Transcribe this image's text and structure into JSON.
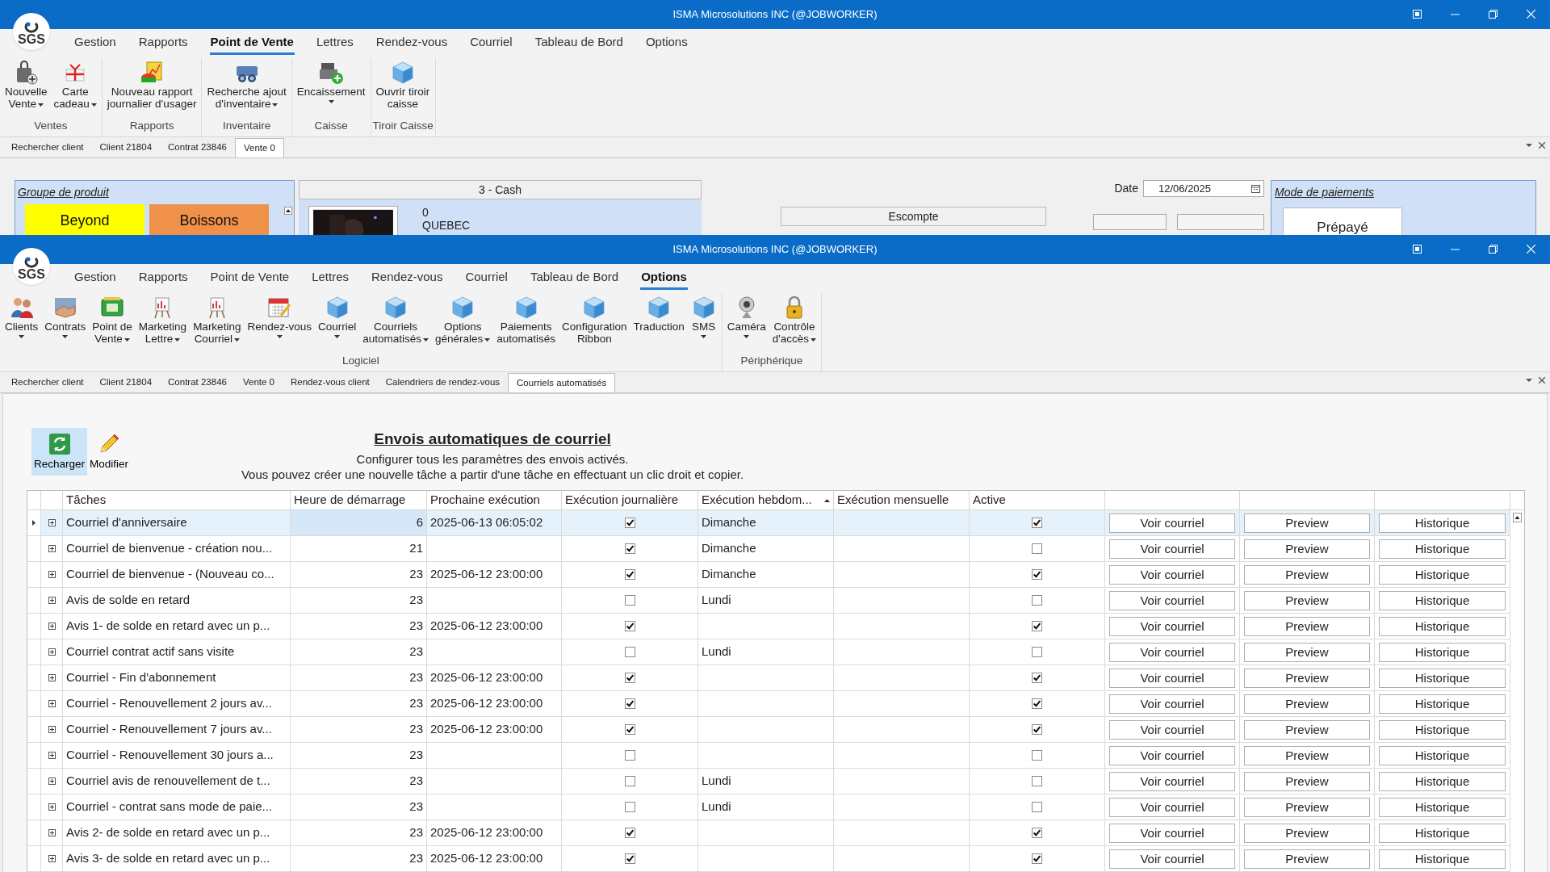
{
  "back_window": {
    "title": "ISMA Microsolutions INC (@JOBWORKER)",
    "logo": "SGS",
    "menu": [
      {
        "label": "Gestion",
        "selected": false
      },
      {
        "label": "Rapports",
        "selected": false
      },
      {
        "label": "Point de Vente",
        "selected": true
      },
      {
        "label": "Lettres",
        "selected": false
      },
      {
        "label": "Rendez-vous",
        "selected": false
      },
      {
        "label": "Courriel",
        "selected": false
      },
      {
        "label": "Tableau de Bord",
        "selected": false
      },
      {
        "label": "Options",
        "selected": false
      }
    ],
    "ribbon": [
      {
        "label": "Ventes",
        "items": [
          {
            "kind": "bag",
            "lines": [
              "Nouvelle",
              "Vente"
            ],
            "dropdown": true
          },
          {
            "kind": "gift",
            "lines": [
              "Carte",
              "cadeau"
            ],
            "dropdown": true
          }
        ]
      },
      {
        "label": "Rapports",
        "items": [
          {
            "kind": "report",
            "lines": [
              "Nouveau rapport",
              "journalier d'usager"
            ],
            "dropdown": false
          }
        ]
      },
      {
        "label": "Inventaire",
        "items": [
          {
            "kind": "binoculars",
            "lines": [
              "Recherche ajout",
              "d'inventaire"
            ],
            "dropdown": true
          }
        ]
      },
      {
        "label": "Caisse",
        "items": [
          {
            "kind": "register",
            "lines": [
              "Encaissement"
            ],
            "dropdown": true
          }
        ]
      },
      {
        "label": "Tiroir Caisse",
        "items": [
          {
            "kind": "cube",
            "lines": [
              "Ouvrir tiroir",
              "caisse"
            ],
            "dropdown": false
          }
        ]
      }
    ],
    "doc_tabs": [
      {
        "label": "Rechercher client",
        "selected": false
      },
      {
        "label": "Client 21804",
        "selected": false
      },
      {
        "label": "Contrat 23846",
        "selected": false
      },
      {
        "label": "Vente 0",
        "selected": true
      }
    ],
    "product_group": {
      "title": "Groupe de produit",
      "products": [
        {
          "label": "Beyond",
          "color": "#ffff00"
        },
        {
          "label": "Boissons",
          "color": "#f0914a"
        }
      ]
    },
    "cash": {
      "title": "3 - Cash",
      "count": "0",
      "region": "QUEBEC"
    },
    "discount": {
      "title": "Escompte"
    },
    "date": {
      "label": "Date",
      "value": "12/06/2025"
    },
    "payment": {
      "title": "Mode de paiements",
      "option": "Prépayé"
    }
  },
  "window": {
    "title": "ISMA Microsolutions INC (@JOBWORKER)",
    "logo": "SGS",
    "menu": [
      {
        "label": "Gestion",
        "selected": false
      },
      {
        "label": "Rapports",
        "selected": false
      },
      {
        "label": "Point de Vente",
        "selected": false
      },
      {
        "label": "Lettres",
        "selected": false
      },
      {
        "label": "Rendez-vous",
        "selected": false
      },
      {
        "label": "Courriel",
        "selected": false
      },
      {
        "label": "Tableau de Bord",
        "selected": false
      },
      {
        "label": "Options",
        "selected": true
      }
    ],
    "ribbon": [
      {
        "label": "Logiciel",
        "items": [
          {
            "kind": "people",
            "lines": [
              "Clients"
            ],
            "dropdown": true
          },
          {
            "kind": "handshake",
            "lines": [
              "Contrats"
            ],
            "dropdown": true
          },
          {
            "kind": "money",
            "lines": [
              "Point de",
              "Vente"
            ],
            "dropdown": true
          },
          {
            "kind": "easel",
            "lines": [
              "Marketing",
              "Lettre"
            ],
            "dropdown": true
          },
          {
            "kind": "easel",
            "lines": [
              "Marketing",
              "Courriel"
            ],
            "dropdown": true
          },
          {
            "kind": "calendar",
            "lines": [
              "Rendez-vous"
            ],
            "dropdown": true
          },
          {
            "kind": "cube",
            "lines": [
              "Courriel"
            ],
            "dropdown": true
          },
          {
            "kind": "cube",
            "lines": [
              "Courriels",
              "automatisés"
            ],
            "dropdown": true
          },
          {
            "kind": "cube",
            "lines": [
              "Options",
              "générales"
            ],
            "dropdown": true
          },
          {
            "kind": "cube",
            "lines": [
              "Paiements",
              "automatisés"
            ],
            "dropdown": false
          },
          {
            "kind": "cube",
            "lines": [
              "Configuration",
              "Ribbon"
            ],
            "dropdown": false
          },
          {
            "kind": "cube",
            "lines": [
              "Traduction"
            ],
            "dropdown": false
          },
          {
            "kind": "cube",
            "lines": [
              "SMS"
            ],
            "dropdown": true
          }
        ]
      },
      {
        "label": "Périphérique",
        "items": [
          {
            "kind": "camera",
            "lines": [
              "Caméra"
            ],
            "dropdown": true
          },
          {
            "kind": "lock",
            "lines": [
              "Contrôle",
              "d'accès"
            ],
            "dropdown": true
          }
        ]
      }
    ],
    "doc_tabs": [
      {
        "label": "Rechercher client",
        "selected": false
      },
      {
        "label": "Client 21804",
        "selected": false
      },
      {
        "label": "Contrat 23846",
        "selected": false
      },
      {
        "label": "Vente 0",
        "selected": false
      },
      {
        "label": "Rendez-vous client",
        "selected": false
      },
      {
        "label": "Calendriers de rendez-vous",
        "selected": false
      },
      {
        "label": "Courriels automatisés",
        "selected": true
      }
    ]
  },
  "toolbar": [
    {
      "kind": "reload",
      "label": "Recharger",
      "selected": true
    },
    {
      "kind": "pencil",
      "label": "Modifier",
      "selected": false
    }
  ],
  "heading": {
    "title": "Envois automatiques de courriel",
    "lines": [
      "Configurer tous les paramètres des envois activés.",
      "Vous pouvez créer une nouvelle tâche a partir d'une tâche en effectuant un clic droit et copier."
    ]
  },
  "table": {
    "columns": [
      {
        "label": "Tâches",
        "sorted": false
      },
      {
        "label": "Heure de démarrage",
        "sorted": false
      },
      {
        "label": "Prochaine exécution",
        "sorted": false
      },
      {
        "label": "Exécution journalière",
        "sorted": false
      },
      {
        "label": "Exécution hebdom...",
        "sorted": true
      },
      {
        "label": "Exécution mensuelle",
        "sorted": false
      },
      {
        "label": "Active",
        "sorted": false
      }
    ],
    "rows": [
      {
        "selected": true,
        "task": "Courriel d'anniversaire",
        "start": "6",
        "next": "2025-06-13 06:05:02",
        "daily": true,
        "weekly": "Dimanche",
        "active": true,
        "buttons": [
          "Voir courriel",
          "Preview",
          "Historique"
        ]
      },
      {
        "selected": false,
        "task": "Courriel de bienvenue - création nou...",
        "start": "21",
        "daily": true,
        "weekly": "Dimanche",
        "active": false,
        "buttons": [
          "Voir courriel",
          "Preview",
          "Historique"
        ]
      },
      {
        "selected": false,
        "task": "Courriel de bienvenue - (Nouveau co...",
        "start": "23",
        "next": "2025-06-12 23:00:00",
        "daily": true,
        "weekly": "Dimanche",
        "active": true,
        "buttons": [
          "Voir courriel",
          "Preview",
          "Historique"
        ]
      },
      {
        "selected": false,
        "task": "Avis de solde en retard",
        "start": "23",
        "daily": false,
        "weekly": "Lundi",
        "active": false,
        "buttons": [
          "Voir courriel",
          "Preview",
          "Historique"
        ]
      },
      {
        "selected": false,
        "task": "Avis 1- de solde en retard avec un p...",
        "start": "23",
        "next": "2025-06-12 23:00:00",
        "daily": true,
        "active": true,
        "buttons": [
          "Voir courriel",
          "Preview",
          "Historique"
        ]
      },
      {
        "selected": false,
        "task": "Courriel contrat actif sans visite",
        "start": "23",
        "daily": false,
        "weekly": "Lundi",
        "active": false,
        "buttons": [
          "Voir courriel",
          "Preview",
          "Historique"
        ]
      },
      {
        "selected": false,
        "task": "Courriel - Fin d'abonnement",
        "start": "23",
        "next": "2025-06-12 23:00:00",
        "daily": true,
        "active": true,
        "buttons": [
          "Voir courriel",
          "Preview",
          "Historique"
        ]
      },
      {
        "selected": false,
        "task": "Courriel - Renouvellement 2 jours av...",
        "start": "23",
        "next": "2025-06-12 23:00:00",
        "daily": true,
        "active": true,
        "buttons": [
          "Voir courriel",
          "Preview",
          "Historique"
        ]
      },
      {
        "selected": false,
        "task": "Courriel - Renouvellement 7 jours av...",
        "start": "23",
        "next": "2025-06-12 23:00:00",
        "daily": true,
        "active": true,
        "buttons": [
          "Voir courriel",
          "Preview",
          "Historique"
        ]
      },
      {
        "selected": false,
        "task": "Courriel - Renouvellement 30 jours a...",
        "start": "23",
        "daily": false,
        "active": false,
        "buttons": [
          "Voir courriel",
          "Preview",
          "Historique"
        ]
      },
      {
        "selected": false,
        "task": "Courriel avis de renouvellement de t...",
        "start": "23",
        "daily": false,
        "weekly": "Lundi",
        "active": false,
        "buttons": [
          "Voir courriel",
          "Preview",
          "Historique"
        ]
      },
      {
        "selected": false,
        "task": "Courriel - contrat sans mode de paie...",
        "start": "23",
        "daily": false,
        "weekly": "Lundi",
        "active": false,
        "buttons": [
          "Voir courriel",
          "Preview",
          "Historique"
        ]
      },
      {
        "selected": false,
        "task": "Avis 2- de solde en retard avec un p...",
        "start": "23",
        "next": "2025-06-12 23:00:00",
        "daily": true,
        "active": true,
        "buttons": [
          "Voir courriel",
          "Preview",
          "Historique"
        ]
      },
      {
        "selected": false,
        "task": "Avis 3- de solde en retard avec un p...",
        "start": "23",
        "next": "2025-06-12 23:00:00",
        "daily": true,
        "active": true,
        "buttons": [
          "Voir courriel",
          "Preview",
          "Historique"
        ]
      }
    ]
  }
}
